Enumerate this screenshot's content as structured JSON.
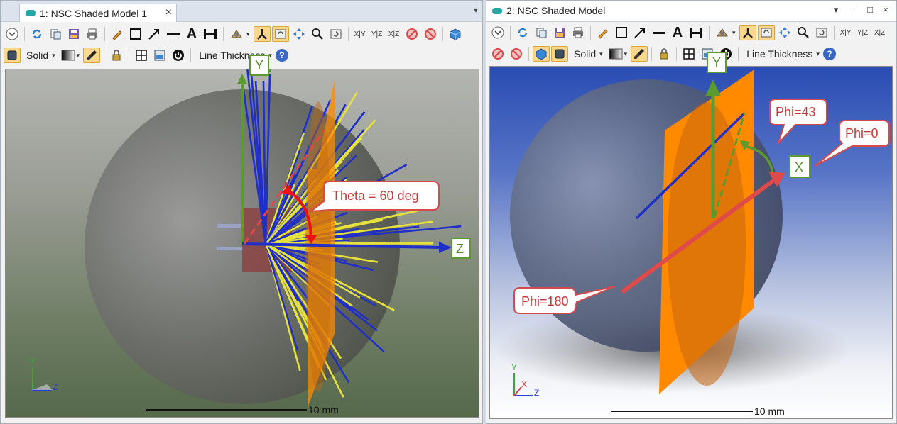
{
  "window1": {
    "tab_title": "1: NSC Shaded Model 1",
    "close_glyph": "×",
    "menu_glyph": "▾",
    "toolbar1": {
      "icons": [
        "settings-expand-icon",
        "refresh-icon",
        "copy-icon",
        "save-icon",
        "print-icon",
        "pencil-icon",
        "rectangle-icon",
        "arrow-icon",
        "line-icon",
        "text-icon",
        "dimension-icon",
        "rotate-view-icon",
        "axes-icon",
        "frame-icon",
        "move-icon",
        "zoom-icon",
        "reset-icon"
      ],
      "axis_labels": [
        "X|Y",
        "Y|Z",
        "X|Z"
      ]
    },
    "toolbar2": {
      "mode_label": "Solid",
      "line_thickness_label": "Line Thickness",
      "help_label": "?"
    },
    "annotations": {
      "y_axis": "Y",
      "z_axis": "Z",
      "theta": "Theta = 60 deg"
    },
    "mini_axes": {
      "y": "Y",
      "z": "Z"
    },
    "scale_label": "10 mm"
  },
  "window2": {
    "title": "2: NSC Shaded Model",
    "controls": {
      "caret": "▾",
      "restore": "▫",
      "maximize": "□",
      "close": "×"
    },
    "toolbar1": {
      "axis_labels": [
        "X|Y",
        "Y|Z",
        "X|Z"
      ]
    },
    "toolbar2": {
      "mode_label": "Solid",
      "line_thickness_label": "Line Thickness",
      "help_label": "?"
    },
    "annotations": {
      "y_axis": "Y",
      "x_axis": "X",
      "phi43": "Phi=43",
      "phi0": "Phi=0",
      "phi180": "Phi=180"
    },
    "mini_axes": {
      "y": "Y",
      "x": "X",
      "z": "Z"
    },
    "scale_label": "10 mm"
  },
  "colors": {
    "accent_green": "#5b9a2e",
    "callout_red": "#d54a4a",
    "ray_blue": "#1f2fc8",
    "ray_yellow": "#e6e23a",
    "detector_orange": "#ff8a00",
    "toolbar_active": "#fbd78e"
  }
}
